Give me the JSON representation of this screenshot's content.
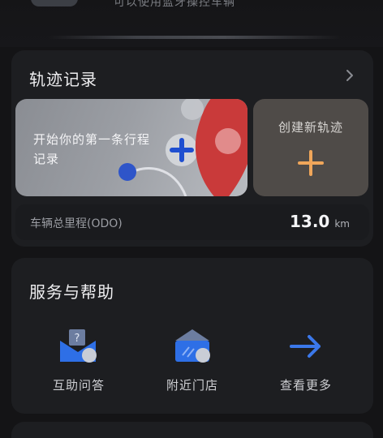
{
  "top": {
    "subtitle": "可以使用蓝牙操控车辆"
  },
  "track": {
    "title": "轨迹记录",
    "first_track_text": "开始你的第一条行程记录",
    "new_track_label": "创建新轨迹",
    "odo_label": "车辆总里程(ODO)",
    "odo_value": "13.0",
    "odo_unit": "km"
  },
  "service": {
    "title": "服务与帮助",
    "items": [
      {
        "label": "互助问答",
        "icon": "qa-envelope-icon"
      },
      {
        "label": "附近门店",
        "icon": "store-icon"
      },
      {
        "label": "查看更多",
        "icon": "arrow-right-icon"
      }
    ]
  },
  "colors": {
    "background": "#141416",
    "card": "#1d1e21",
    "accent_orange": "#f0a65a",
    "accent_blue": "#2e6fe6",
    "accent_red": "#c93a3a"
  }
}
